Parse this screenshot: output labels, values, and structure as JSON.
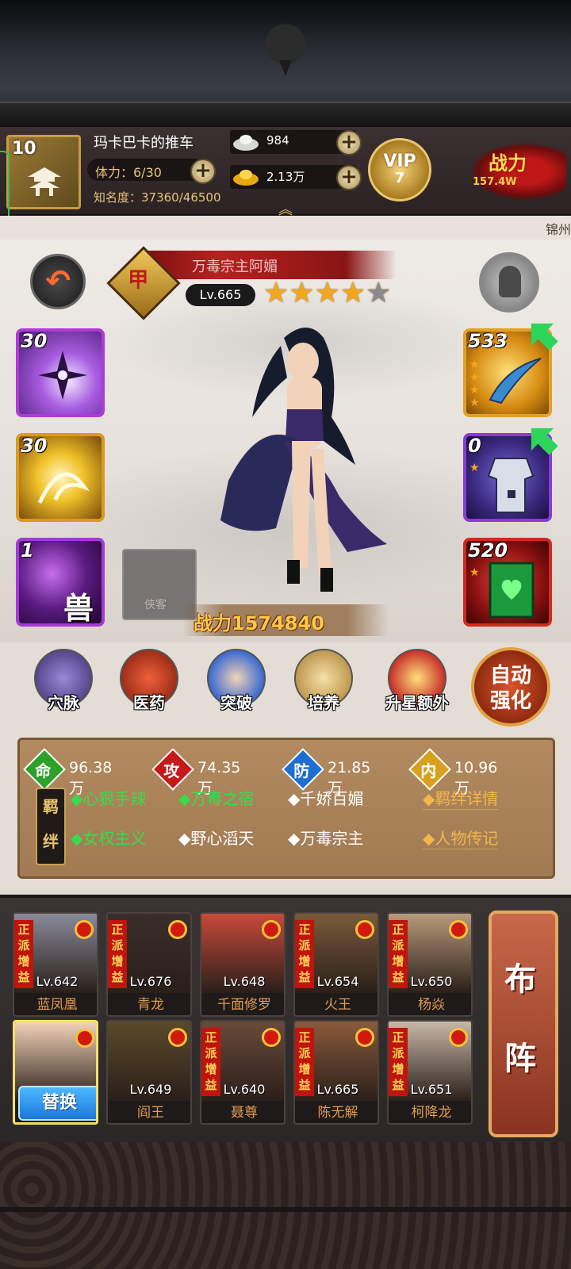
{
  "player": {
    "level": "10",
    "name": "玛卡巴卡的推车",
    "stamina": "体力：6/30",
    "fame": "知名度：37360/46500"
  },
  "resources": {
    "silver": "984",
    "gold": "2.13万"
  },
  "vip": {
    "label": "VIP",
    "level": "7"
  },
  "power_badge": {
    "title": "战力",
    "value": "157.4W"
  },
  "location": "锦州",
  "hero": {
    "title": "万毒宗主阿媚",
    "rank": "甲",
    "level": "Lv.665",
    "stars_filled": 4,
    "stars_total": 5,
    "combat_power": "战力1574840",
    "placeholder_label": "侠客"
  },
  "skills": [
    {
      "num": "30"
    },
    {
      "num": "30"
    },
    {
      "num": "1",
      "glyph": "兽"
    }
  ],
  "equipment": [
    {
      "num": "533"
    },
    {
      "num": "0"
    },
    {
      "num": "520"
    }
  ],
  "functions": [
    "穴脉",
    "医药",
    "突破",
    "培养",
    "升星额外"
  ],
  "auto_enhance": [
    "自动",
    "强化"
  ],
  "stats": [
    {
      "key": "命",
      "value": "96.38万",
      "color": "#2ea12a"
    },
    {
      "key": "攻",
      "value": "74.35万",
      "color": "#c61a1a"
    },
    {
      "key": "防",
      "value": "21.85万",
      "color": "#1f6ed1"
    },
    {
      "key": "内",
      "value": "10.96万",
      "color": "#d9a01e"
    }
  ],
  "bond_label": "羁绊",
  "bonds": [
    {
      "text": "◆心狠手辣",
      "active": true
    },
    {
      "text": "◆万毒之宿",
      "active": true
    },
    {
      "text": "◆千娇百媚",
      "active": false
    },
    {
      "text": "◆女权主义",
      "active": true
    },
    {
      "text": "◆野心滔天",
      "active": false
    },
    {
      "text": "◆万毒宗主",
      "active": false
    }
  ],
  "bond_links": [
    "◆羁绊详情",
    "◆人物传记"
  ],
  "team": [
    {
      "level": "Lv.642",
      "name": "蓝凤凰",
      "buff": "正派增益"
    },
    {
      "level": "Lv.676",
      "name": "青龙",
      "buff": "正派增益"
    },
    {
      "level": "Lv.648",
      "name": "千面修罗",
      "buff": ""
    },
    {
      "level": "Lv.654",
      "name": "火王",
      "buff": "正派增益"
    },
    {
      "level": "Lv.650",
      "name": "杨焱",
      "buff": "正派增益"
    },
    {
      "level": "",
      "name": "",
      "buff": "",
      "swap": "替换"
    },
    {
      "level": "Lv.649",
      "name": "阎王",
      "buff": ""
    },
    {
      "level": "Lv.640",
      "name": "聂尊",
      "buff": "正派增益"
    },
    {
      "level": "Lv.665",
      "name": "陈无解",
      "buff": "正派增益"
    },
    {
      "level": "Lv.651",
      "name": "柯降龙",
      "buff": "正派增益"
    }
  ],
  "formation": [
    "布",
    "阵"
  ]
}
